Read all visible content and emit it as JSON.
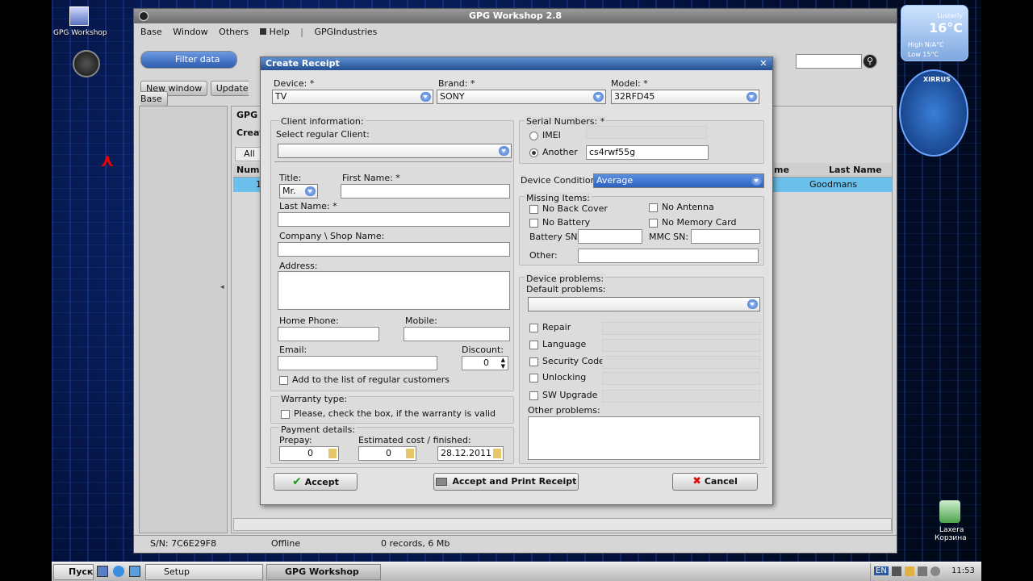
{
  "app": {
    "title": "GPG Workshop 2.8",
    "menu": [
      "Base",
      "Window",
      "Others",
      "Help",
      "GPGIndustries"
    ],
    "filter_label": "Filter data",
    "toolbar": [
      "New window",
      "Update Base"
    ],
    "tab_partial": "GPG",
    "create_partial": "Creat",
    "all_label": "All",
    "col_num": "Num",
    "col_last_name": "Last Name",
    "col_name_partial": "me",
    "row_last_name": "Goodmans",
    "row_num_partial": "1"
  },
  "dialog": {
    "title": "Create Receipt",
    "device_label": "Device: *",
    "device_value": "TV",
    "brand_label": "Brand: *",
    "brand_value": "SONY",
    "model_label": "Model: *",
    "model_value": "32RFD45",
    "client_group": "Client information:",
    "select_client": "Select regular Client:",
    "title_label": "Title:",
    "title_value": "Mr.",
    "first_name": "First Name: *",
    "last_name": "Last Name: *",
    "company": "Company \\ Shop Name:",
    "address": "Address:",
    "home_phone": "Home Phone:",
    "mobile": "Mobile:",
    "email": "Email:",
    "discount": "Discount:",
    "discount_value": "0",
    "add_regular": "Add to the list of regular customers",
    "warranty_group": "Warranty type:",
    "warranty_check": "Please, check the box, if the warranty is valid",
    "payment_group": "Payment details:",
    "prepay": "Prepay:",
    "prepay_value": "0",
    "estimated": "Estimated cost / finished:",
    "estimated_value": "0",
    "date_value": "28.12.2011",
    "serial_group": "Serial Numbers: *",
    "imei": "IMEI",
    "another": "Another",
    "serial_value": "cs4rwf55g",
    "condition_label": "Device Condition:",
    "condition_value": "Average",
    "missing_group": "Missing Items:",
    "no_back_cover": "No Back Cover",
    "no_antenna": "No Antenna",
    "no_battery": "No Battery",
    "no_memory_card": "No Memory Card",
    "battery_sn": "Battery SN:",
    "mmc_sn": "MMC SN:",
    "other": "Other:",
    "problems_group": "Device problems:",
    "default_problems": "Default problems:",
    "problems": [
      "Repair",
      "Language",
      "Security Code",
      "Unlocking",
      "SW Upgrade"
    ],
    "other_problems": "Other problems:",
    "accept": "Accept",
    "accept_print": "Accept and Print Receipt",
    "cancel": "Cancel"
  },
  "status": {
    "sn": "S/N: 7C6E29F8",
    "offline": "Offline",
    "records": "0 records, 6 Mb"
  },
  "desktop": {
    "icon_label": "GPG Workshop",
    "weather_city": "Lusterly",
    "weather_temp": "16°C",
    "weather_high": "High N/A°C",
    "weather_low": "Low 15°C",
    "wifi_brand": "XIRRUS",
    "trash_label1": "Laxera",
    "trash_label2": "Корзина"
  },
  "taskbar": {
    "start": "Пуск",
    "setup": "Setup",
    "app": "GPG Workshop",
    "lang": "EN",
    "clock": "11:53"
  }
}
